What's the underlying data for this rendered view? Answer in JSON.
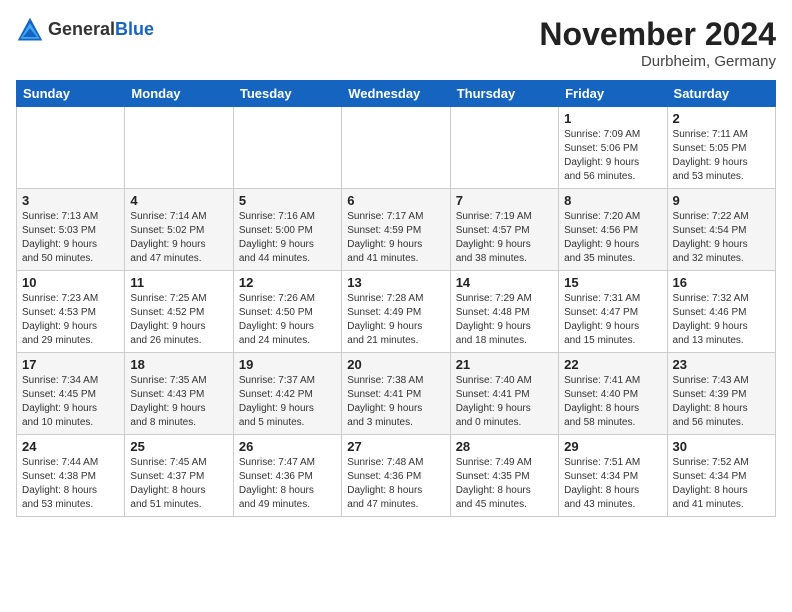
{
  "header": {
    "logo_general": "General",
    "logo_blue": "Blue",
    "month_title": "November 2024",
    "location": "Durbheim, Germany"
  },
  "weekdays": [
    "Sunday",
    "Monday",
    "Tuesday",
    "Wednesday",
    "Thursday",
    "Friday",
    "Saturday"
  ],
  "weeks": [
    [
      {
        "day": "",
        "info": ""
      },
      {
        "day": "",
        "info": ""
      },
      {
        "day": "",
        "info": ""
      },
      {
        "day": "",
        "info": ""
      },
      {
        "day": "",
        "info": ""
      },
      {
        "day": "1",
        "info": "Sunrise: 7:09 AM\nSunset: 5:06 PM\nDaylight: 9 hours\nand 56 minutes."
      },
      {
        "day": "2",
        "info": "Sunrise: 7:11 AM\nSunset: 5:05 PM\nDaylight: 9 hours\nand 53 minutes."
      }
    ],
    [
      {
        "day": "3",
        "info": "Sunrise: 7:13 AM\nSunset: 5:03 PM\nDaylight: 9 hours\nand 50 minutes."
      },
      {
        "day": "4",
        "info": "Sunrise: 7:14 AM\nSunset: 5:02 PM\nDaylight: 9 hours\nand 47 minutes."
      },
      {
        "day": "5",
        "info": "Sunrise: 7:16 AM\nSunset: 5:00 PM\nDaylight: 9 hours\nand 44 minutes."
      },
      {
        "day": "6",
        "info": "Sunrise: 7:17 AM\nSunset: 4:59 PM\nDaylight: 9 hours\nand 41 minutes."
      },
      {
        "day": "7",
        "info": "Sunrise: 7:19 AM\nSunset: 4:57 PM\nDaylight: 9 hours\nand 38 minutes."
      },
      {
        "day": "8",
        "info": "Sunrise: 7:20 AM\nSunset: 4:56 PM\nDaylight: 9 hours\nand 35 minutes."
      },
      {
        "day": "9",
        "info": "Sunrise: 7:22 AM\nSunset: 4:54 PM\nDaylight: 9 hours\nand 32 minutes."
      }
    ],
    [
      {
        "day": "10",
        "info": "Sunrise: 7:23 AM\nSunset: 4:53 PM\nDaylight: 9 hours\nand 29 minutes."
      },
      {
        "day": "11",
        "info": "Sunrise: 7:25 AM\nSunset: 4:52 PM\nDaylight: 9 hours\nand 26 minutes."
      },
      {
        "day": "12",
        "info": "Sunrise: 7:26 AM\nSunset: 4:50 PM\nDaylight: 9 hours\nand 24 minutes."
      },
      {
        "day": "13",
        "info": "Sunrise: 7:28 AM\nSunset: 4:49 PM\nDaylight: 9 hours\nand 21 minutes."
      },
      {
        "day": "14",
        "info": "Sunrise: 7:29 AM\nSunset: 4:48 PM\nDaylight: 9 hours\nand 18 minutes."
      },
      {
        "day": "15",
        "info": "Sunrise: 7:31 AM\nSunset: 4:47 PM\nDaylight: 9 hours\nand 15 minutes."
      },
      {
        "day": "16",
        "info": "Sunrise: 7:32 AM\nSunset: 4:46 PM\nDaylight: 9 hours\nand 13 minutes."
      }
    ],
    [
      {
        "day": "17",
        "info": "Sunrise: 7:34 AM\nSunset: 4:45 PM\nDaylight: 9 hours\nand 10 minutes."
      },
      {
        "day": "18",
        "info": "Sunrise: 7:35 AM\nSunset: 4:43 PM\nDaylight: 9 hours\nand 8 minutes."
      },
      {
        "day": "19",
        "info": "Sunrise: 7:37 AM\nSunset: 4:42 PM\nDaylight: 9 hours\nand 5 minutes."
      },
      {
        "day": "20",
        "info": "Sunrise: 7:38 AM\nSunset: 4:41 PM\nDaylight: 9 hours\nand 3 minutes."
      },
      {
        "day": "21",
        "info": "Sunrise: 7:40 AM\nSunset: 4:41 PM\nDaylight: 9 hours\nand 0 minutes."
      },
      {
        "day": "22",
        "info": "Sunrise: 7:41 AM\nSunset: 4:40 PM\nDaylight: 8 hours\nand 58 minutes."
      },
      {
        "day": "23",
        "info": "Sunrise: 7:43 AM\nSunset: 4:39 PM\nDaylight: 8 hours\nand 56 minutes."
      }
    ],
    [
      {
        "day": "24",
        "info": "Sunrise: 7:44 AM\nSunset: 4:38 PM\nDaylight: 8 hours\nand 53 minutes."
      },
      {
        "day": "25",
        "info": "Sunrise: 7:45 AM\nSunset: 4:37 PM\nDaylight: 8 hours\nand 51 minutes."
      },
      {
        "day": "26",
        "info": "Sunrise: 7:47 AM\nSunset: 4:36 PM\nDaylight: 8 hours\nand 49 minutes."
      },
      {
        "day": "27",
        "info": "Sunrise: 7:48 AM\nSunset: 4:36 PM\nDaylight: 8 hours\nand 47 minutes."
      },
      {
        "day": "28",
        "info": "Sunrise: 7:49 AM\nSunset: 4:35 PM\nDaylight: 8 hours\nand 45 minutes."
      },
      {
        "day": "29",
        "info": "Sunrise: 7:51 AM\nSunset: 4:34 PM\nDaylight: 8 hours\nand 43 minutes."
      },
      {
        "day": "30",
        "info": "Sunrise: 7:52 AM\nSunset: 4:34 PM\nDaylight: 8 hours\nand 41 minutes."
      }
    ]
  ]
}
